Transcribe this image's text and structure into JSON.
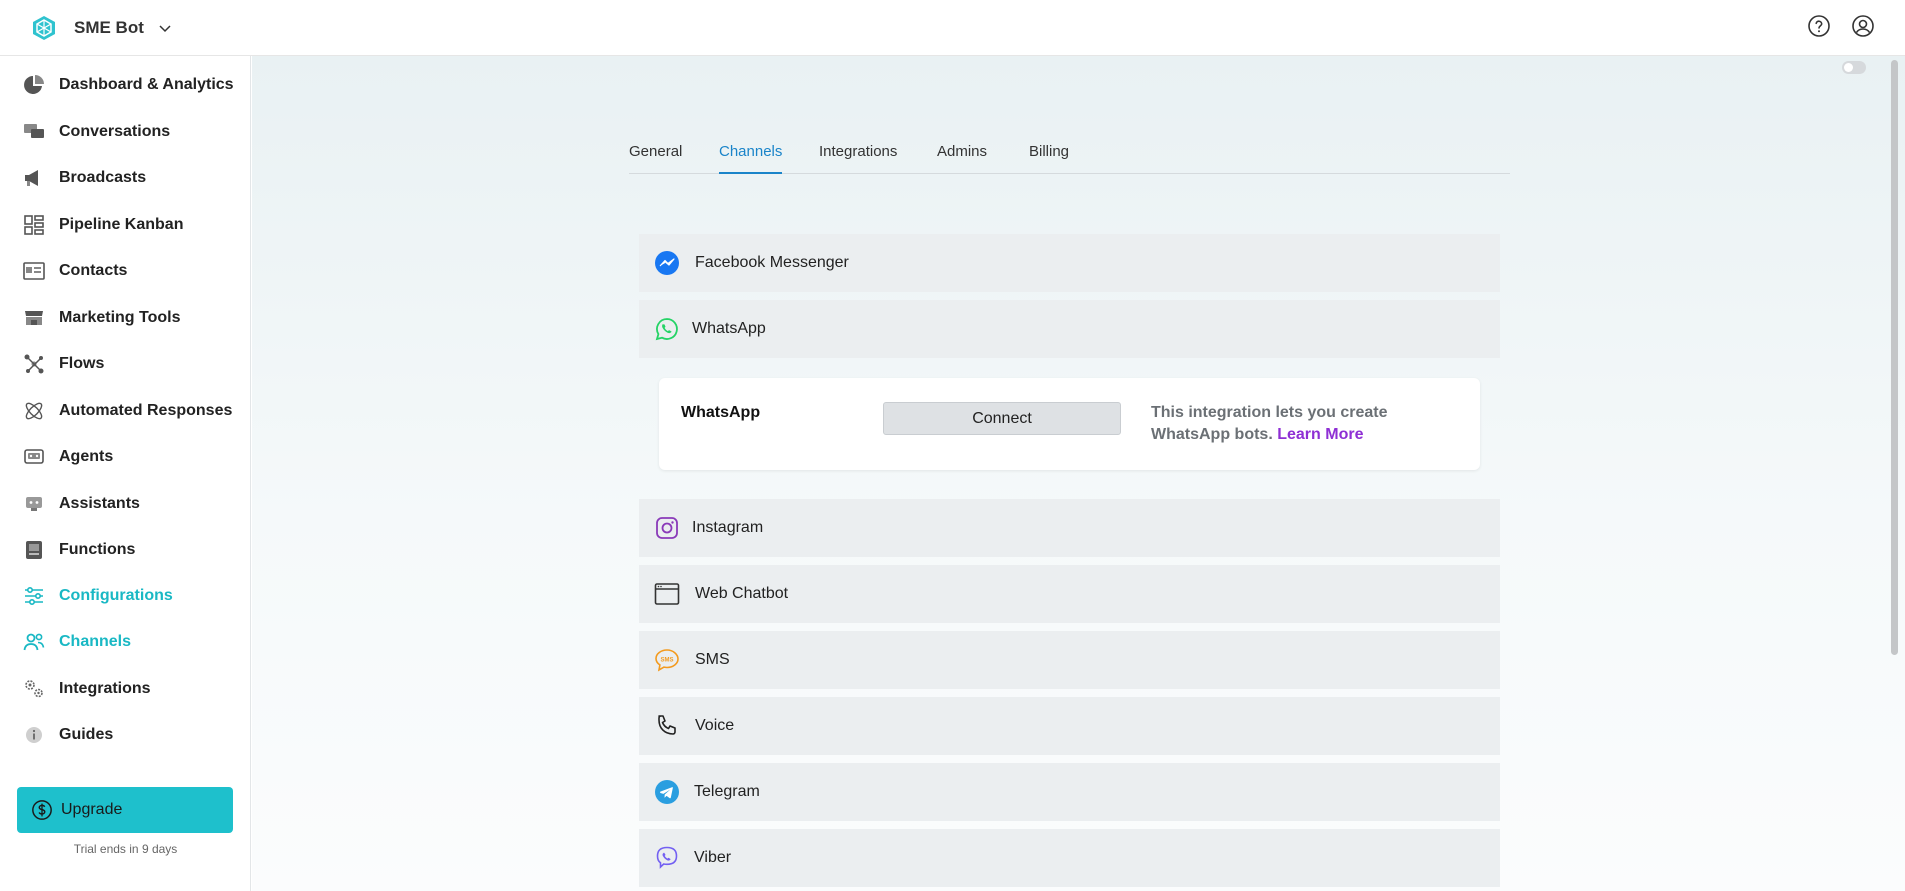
{
  "header": {
    "app_name": "SME Bot"
  },
  "sidebar": {
    "items": [
      {
        "label": "Dashboard & Analytics",
        "icon": "pie-chart-icon",
        "active": false
      },
      {
        "label": "Conversations",
        "icon": "chat-bubbles-icon",
        "active": false
      },
      {
        "label": "Broadcasts",
        "icon": "megaphone-icon",
        "active": false
      },
      {
        "label": "Pipeline Kanban",
        "icon": "kanban-icon",
        "active": false
      },
      {
        "label": "Contacts",
        "icon": "contact-card-icon",
        "active": false
      },
      {
        "label": "Marketing Tools",
        "icon": "store-icon",
        "active": false
      },
      {
        "label": "Flows",
        "icon": "flow-icon",
        "active": false
      },
      {
        "label": "Automated Responses",
        "icon": "atom-icon",
        "active": false
      },
      {
        "label": "Agents",
        "icon": "agent-icon",
        "active": false
      },
      {
        "label": "Assistants",
        "icon": "assistant-icon",
        "active": false
      },
      {
        "label": "Functions",
        "icon": "function-icon",
        "active": false
      },
      {
        "label": "Configurations",
        "icon": "sliders-icon",
        "active": true
      },
      {
        "label": "Channels",
        "icon": "users-icon",
        "active": true
      },
      {
        "label": "Integrations",
        "icon": "gears-icon",
        "active": false
      },
      {
        "label": "Guides",
        "icon": "info-icon",
        "active": false
      }
    ],
    "upgrade_label": "Upgrade",
    "trial_text": "Trial ends in 9 days"
  },
  "tabs": [
    {
      "label": "General",
      "active": false
    },
    {
      "label": "Channels",
      "active": true
    },
    {
      "label": "Integrations",
      "active": false
    },
    {
      "label": "Admins",
      "active": false
    },
    {
      "label": "Billing",
      "active": false
    }
  ],
  "channels": [
    {
      "label": "Facebook Messenger",
      "icon": "messenger-icon"
    },
    {
      "label": "WhatsApp",
      "icon": "whatsapp-icon"
    },
    {
      "label": "Instagram",
      "icon": "instagram-icon"
    },
    {
      "label": "Web Chatbot",
      "icon": "browser-window-icon"
    },
    {
      "label": "SMS",
      "icon": "sms-icon"
    },
    {
      "label": "Voice",
      "icon": "phone-icon"
    },
    {
      "label": "Telegram",
      "icon": "telegram-icon"
    },
    {
      "label": "Viber",
      "icon": "viber-icon"
    }
  ],
  "whatsapp_panel": {
    "title": "WhatsApp",
    "connect_label": "Connect",
    "description": "This integration lets you create WhatsApp bots.",
    "learn_more": "Learn More"
  },
  "colors": {
    "accent": "#1ec0cc",
    "active_nav": "#19b8c4",
    "active_tab": "#1a84c9",
    "learn_more": "#8e2fd4"
  }
}
